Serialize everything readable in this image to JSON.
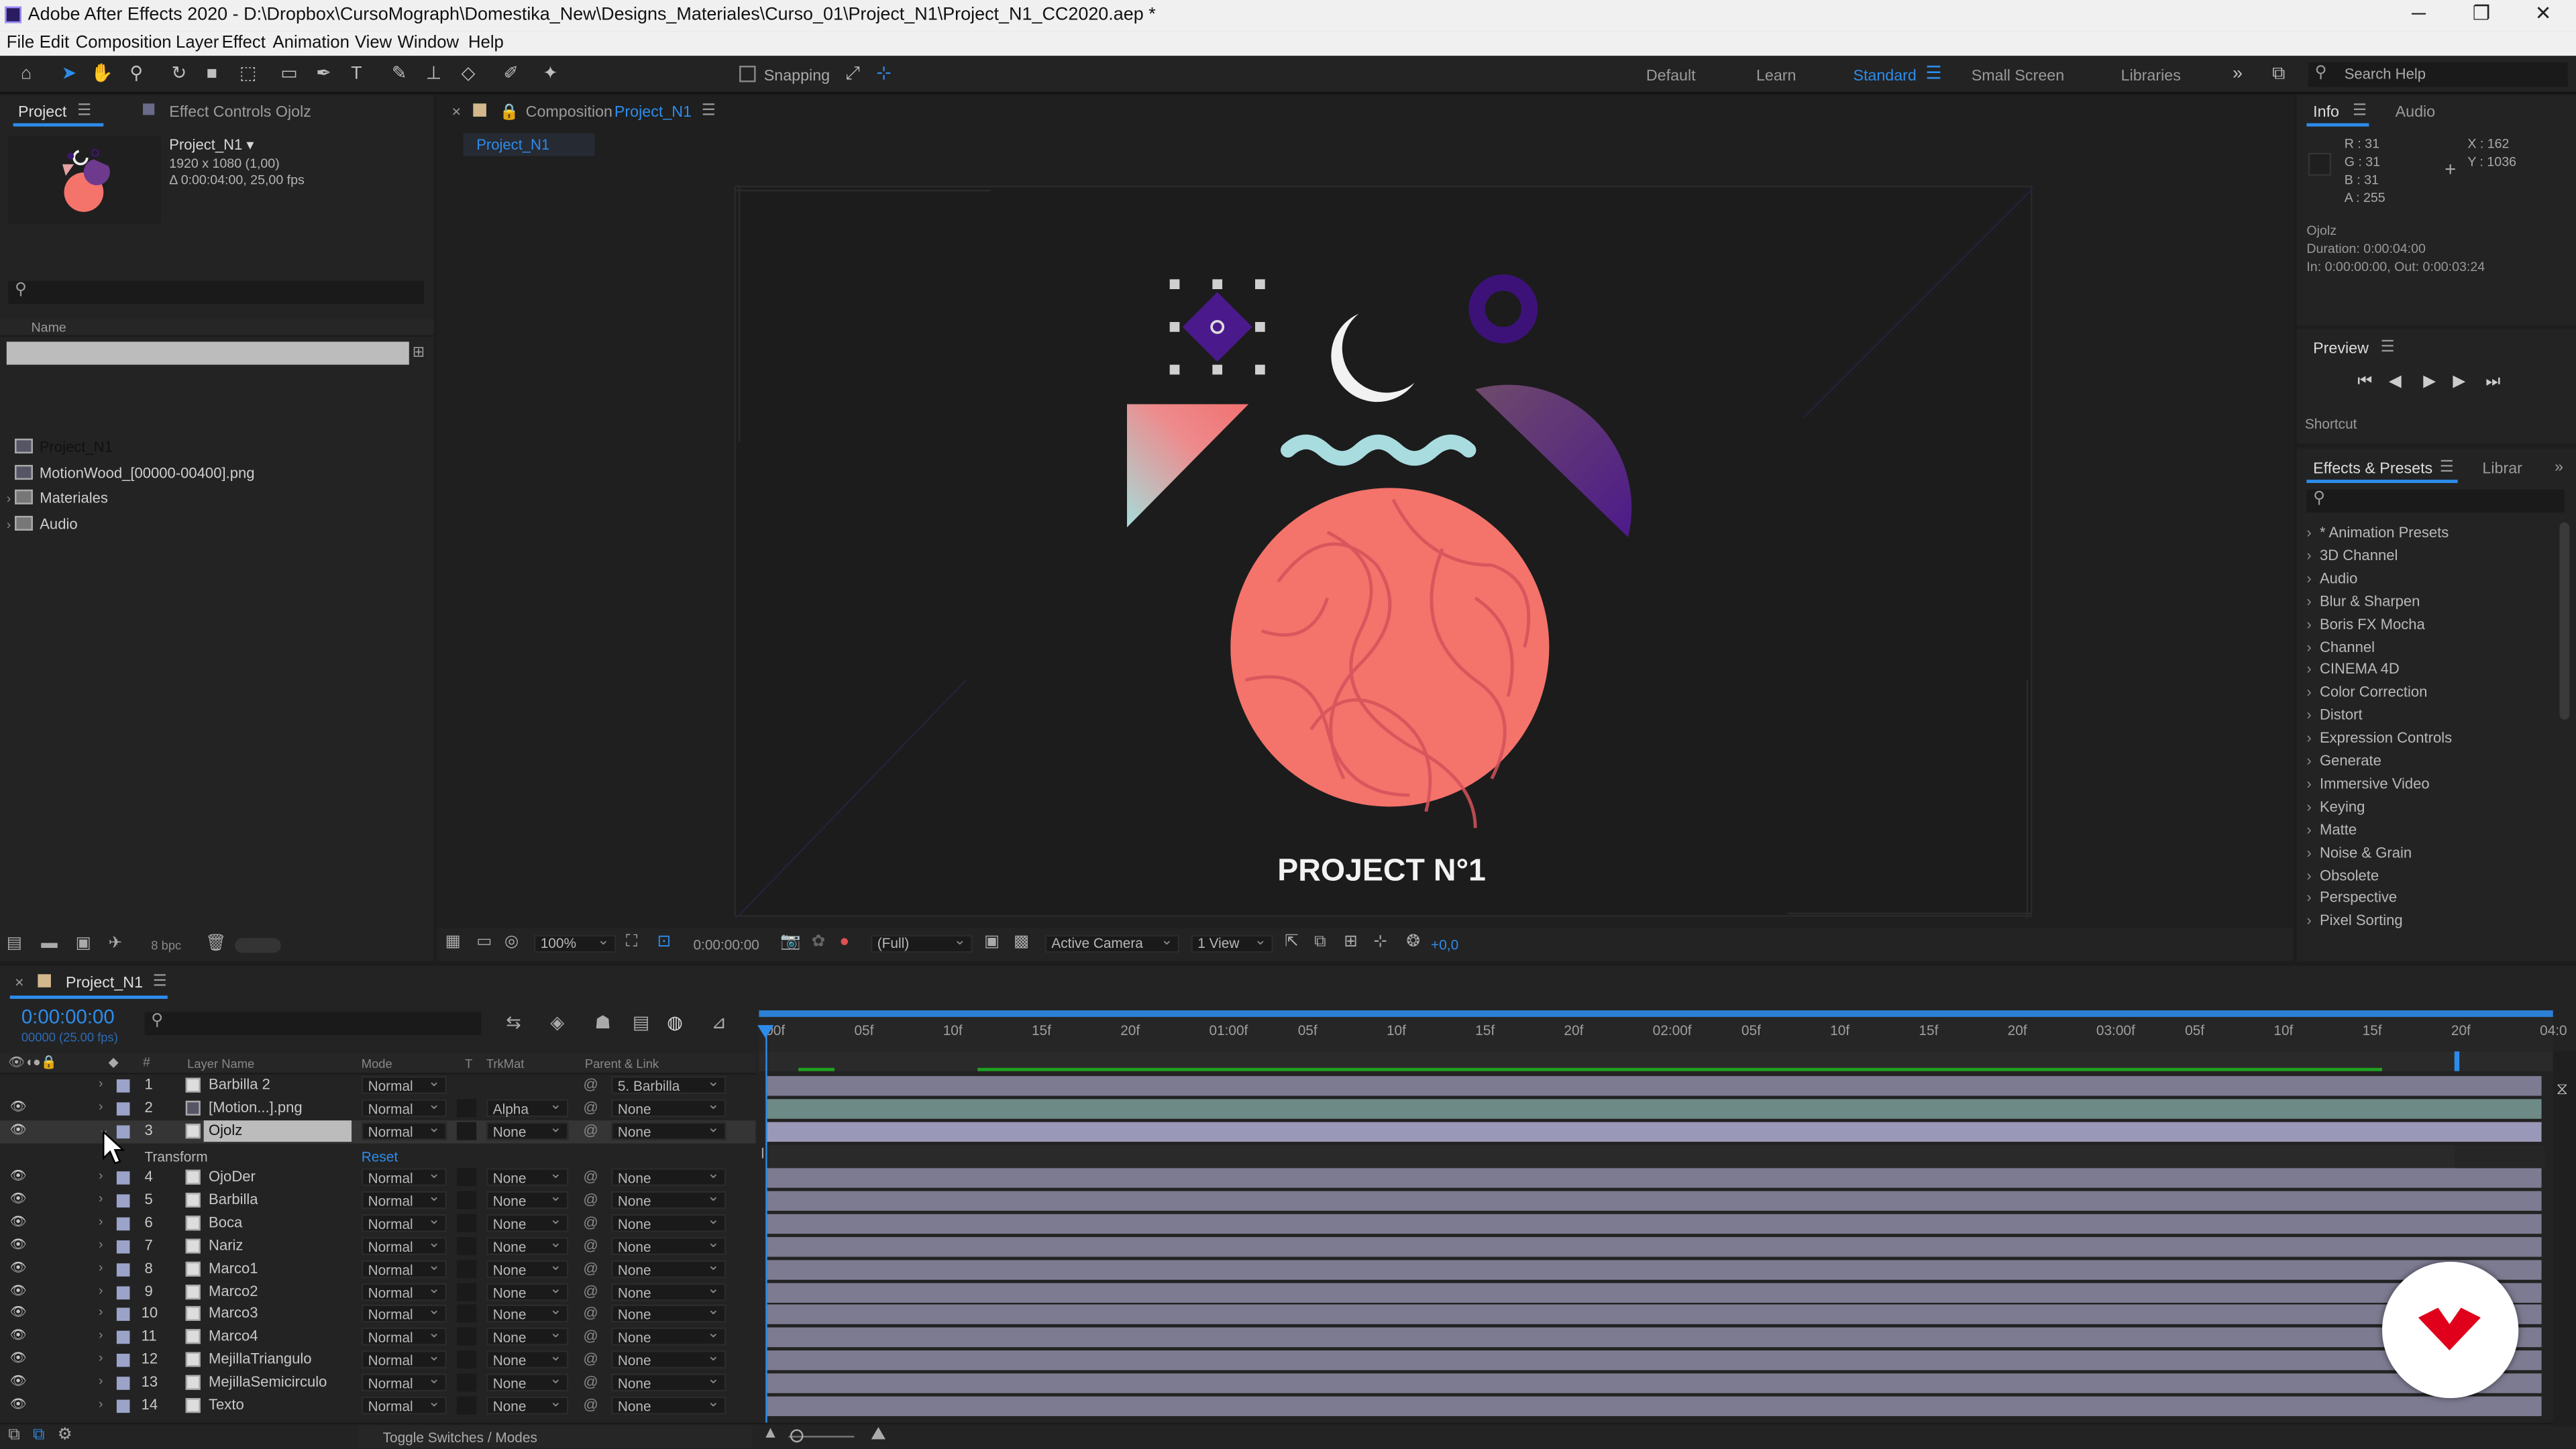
{
  "window": {
    "title": "Adobe After Effects 2020 - D:\\Dropbox\\CursoMograph\\Domestika_New\\Designs_Materiales\\Curso_01\\Project_N1\\Project_N1_CC2020.aep *"
  },
  "menu": [
    "File",
    "Edit",
    "Composition",
    "Layer",
    "Effect",
    "Animation",
    "View",
    "Window",
    "Help"
  ],
  "toolbar": {
    "snapping": "Snapping",
    "workspaces": [
      "Default",
      "Learn",
      "Standard",
      "Small Screen",
      "Libraries"
    ],
    "active_workspace": "Standard",
    "search_help": "Search Help"
  },
  "project_panel": {
    "tab": "Project",
    "effect_controls_tab": "Effect Controls Ojolz",
    "comp_name": "Project_N1 ▾",
    "comp_info1": "1920 x 1080 (1,00)",
    "comp_info2": "Δ 0:00:04:00, 25,00 fps",
    "column_name": "Name",
    "items": [
      {
        "name": "Project_N1",
        "icon": "composition-icon"
      },
      {
        "name": "MotionWood_[00000-00400].png",
        "icon": "footage-icon"
      },
      {
        "name": "Materiales",
        "icon": "folder-icon"
      },
      {
        "name": "Audio",
        "icon": "folder-icon"
      }
    ],
    "bpc": "8 bpc"
  },
  "composition_panel": {
    "tab_prefix": "Composition",
    "tab_name": "Project_N1",
    "subtab": "Project_N1",
    "canvas_title": "PROJECT N°1",
    "zoom": "100%",
    "timecode": "0:00:00:00",
    "resolution": "(Full)",
    "camera": "Active Camera",
    "views": "1 View",
    "exposure": "+0,0"
  },
  "info_panel": {
    "tab": "Info",
    "audio_tab": "Audio",
    "r": "R : 31",
    "g": "G : 31",
    "b": "B : 31",
    "a": "A : 255",
    "x": "X : 162",
    "y": "Y : 1036",
    "layer": "Ojolz",
    "duration": "Duration: 0:00:04:00",
    "inout": "In: 0:00:00:00, Out: 0:00:03:24"
  },
  "preview_panel": {
    "tab": "Preview",
    "shortcut": "Shortcut"
  },
  "effects_panel": {
    "tab": "Effects & Presets",
    "libraries_tab": "Librar",
    "items": [
      "* Animation Presets",
      "3D Channel",
      "Audio",
      "Blur & Sharpen",
      "Boris FX Mocha",
      "Channel",
      "CINEMA 4D",
      "Color Correction",
      "Distort",
      "Expression Controls",
      "Generate",
      "Immersive Video",
      "Keying",
      "Matte",
      "Noise & Grain",
      "Obsolete",
      "Perspective",
      "Pixel Sorting"
    ]
  },
  "timeline": {
    "tab": "Project_N1",
    "timecode": "0:00:00:00",
    "frames": "00000 (25.00 fps)",
    "col_layer_name": "Layer Name",
    "col_mode": "Mode",
    "col_t": "T",
    "col_trkmat": "TrkMat",
    "col_parent": "Parent & Link",
    "transform_label": "Transform",
    "reset_label": "Reset",
    "toggle_label": "Toggle Switches / Modes",
    "ruler": [
      "00f",
      "05f",
      "10f",
      "15f",
      "20f",
      "01:00f",
      "05f",
      "10f",
      "15f",
      "20f",
      "02:00f",
      "05f",
      "10f",
      "15f",
      "20f",
      "03:00f",
      "05f",
      "10f",
      "15f",
      "20f",
      "04:0"
    ],
    "layers": [
      {
        "num": "1",
        "name": "Barbilla 2",
        "mode": "Normal",
        "trkmat": "",
        "parent": "5. Barbilla",
        "bar_color": "#7c7b91"
      },
      {
        "num": "2",
        "name": "[Motion...].png",
        "mode": "Normal",
        "trkmat": "Alpha",
        "parent": "None",
        "bar_color": "#6e8a86"
      },
      {
        "num": "3",
        "name": "Ojolz",
        "mode": "Normal",
        "trkmat": "None",
        "parent": "None",
        "bar_color": "#9a98b8"
      },
      {
        "num": "4",
        "name": "OjoDer",
        "mode": "Normal",
        "trkmat": "None",
        "parent": "None",
        "bar_color": "#7c7b91"
      },
      {
        "num": "5",
        "name": "Barbilla",
        "mode": "Normal",
        "trkmat": "None",
        "parent": "None",
        "bar_color": "#7c7b91"
      },
      {
        "num": "6",
        "name": "Boca",
        "mode": "Normal",
        "trkmat": "None",
        "parent": "None",
        "bar_color": "#7c7b91"
      },
      {
        "num": "7",
        "name": "Nariz",
        "mode": "Normal",
        "trkmat": "None",
        "parent": "None",
        "bar_color": "#7c7b91"
      },
      {
        "num": "8",
        "name": "Marco1",
        "mode": "Normal",
        "trkmat": "None",
        "parent": "None",
        "bar_color": "#7c7b91"
      },
      {
        "num": "9",
        "name": "Marco2",
        "mode": "Normal",
        "trkmat": "None",
        "parent": "None",
        "bar_color": "#7c7b91"
      },
      {
        "num": "10",
        "name": "Marco3",
        "mode": "Normal",
        "trkmat": "None",
        "parent": "None",
        "bar_color": "#7c7b91"
      },
      {
        "num": "11",
        "name": "Marco4",
        "mode": "Normal",
        "trkmat": "None",
        "parent": "None",
        "bar_color": "#7c7b91"
      },
      {
        "num": "12",
        "name": "MejillaTriangulo",
        "mode": "Normal",
        "trkmat": "None",
        "parent": "None",
        "bar_color": "#7c7b91"
      },
      {
        "num": "13",
        "name": "MejillaSemicirculo",
        "mode": "Normal",
        "trkmat": "None",
        "parent": "None",
        "bar_color": "#7c7b91"
      },
      {
        "num": "14",
        "name": "Texto",
        "mode": "Normal",
        "trkmat": "None",
        "parent": "None",
        "bar_color": "#7c7b91"
      }
    ]
  },
  "colors": {
    "accent": "#2d8ceb",
    "coral": "#f4736b",
    "purple": "#4a1a8c",
    "teal": "#a9dcdf",
    "bar": "#7c7b91",
    "domestika": "#e0001b"
  }
}
